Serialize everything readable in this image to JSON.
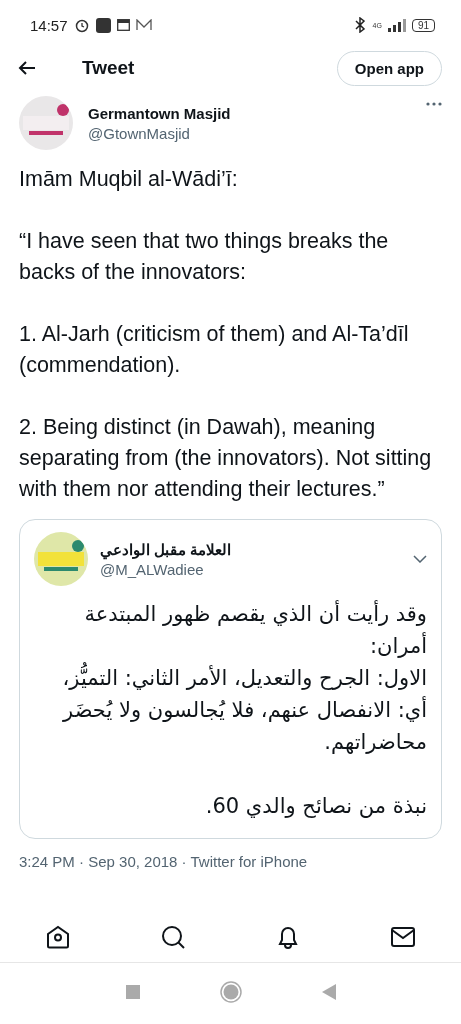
{
  "status_bar": {
    "time": "14:57",
    "network": "4G",
    "battery": "91"
  },
  "header": {
    "title": "Tweet",
    "open_app": "Open app"
  },
  "author": {
    "name": "Germantown Masjid",
    "handle": "@GtownMasjid"
  },
  "tweet_paragraphs": [
    "Imām Muqbil al-Wādi’ī:",
    "“I have seen that two things breaks the backs of the innovators:",
    "1. Al-Jarh (criticism of them) and Al-Ta’dīl (commendation).",
    "2.  Being distinct (in Dawah), meaning separating from (the innovators). Not sitting with them nor attending their lectures.”"
  ],
  "quoted_tweet": {
    "name": "العلامة مقبل الوادعي",
    "handle": "@M_ALWadiee",
    "text": "وقد رأيت أن الذي يقصم ظهور المبتدعة أمران:\nالاول: الجرح والتعديل، الأمر الثاني: التميُّز، أي: الانفصال عنهم، فلا يُجالسون ولا يُحضَر محاضراتهم.\n\nنبذة من نصائح والدي 60."
  },
  "timestamp": "3:24 PM · Sep 30, 2018 · Twitter for iPhone"
}
